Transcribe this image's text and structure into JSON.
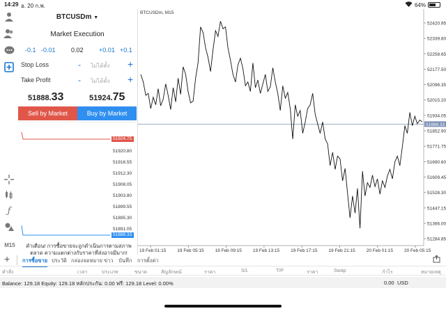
{
  "statusbar": {
    "time": "14:29",
    "date": "อ. 20 ก.พ.",
    "battery": "64%",
    "battery_level": 0.64
  },
  "toolbar_icons": [
    "user-icon",
    "users-icon",
    "chat-icon",
    "new-order-icon",
    "crosshair-icon",
    "chart-type-icon",
    "function-icon",
    "objects-icon"
  ],
  "timeframe": "M15",
  "order": {
    "symbol": "BTCUSDm",
    "execution": "Market Execution",
    "vol_minus_big": "-0.1",
    "vol_minus_small": "-0.01",
    "volume": "0.02",
    "vol_plus_small": "+0.01",
    "vol_plus_big": "+0.1",
    "stop_loss_label": "Stop Loss",
    "take_profit_label": "Take Profit",
    "not_set": "ไม่ได้ตั้ง",
    "bid_prefix": "51888.",
    "bid_big": "33",
    "ask_prefix": "51924.",
    "ask_big": "75",
    "sell_label": "Sell by Market",
    "buy_label": "Buy by Market",
    "warning": "คำเตือน! การซื้อขายจะถูกดำเนินการตามสภาพตลาด ความแตกต่างกับราคาที่ส่งอาจมีมาก!"
  },
  "tick_chart": {
    "ask_tag": "51924.75",
    "bid_tag": "51888.33",
    "levels": [
      "51920.80",
      "51916.55",
      "51912.30",
      "51908.05",
      "51903.80",
      "51899.55",
      "51895.30",
      "51891.05"
    ]
  },
  "chart_data": {
    "type": "line",
    "title": "BTCUSDm, M15",
    "x_labels": [
      "19 Feb 01:15",
      "19 Feb 05:15",
      "19 Feb 09:15",
      "19 Feb 13:15",
      "19 Feb 17:15",
      "19 Feb 21:15",
      "20 Feb 01:15",
      "20 Feb 05:15"
    ],
    "y_labels": [
      "52420.95",
      "52339.80",
      "52258.65",
      "52177.50",
      "52096.35",
      "52015.20",
      "51934.05",
      "51852.90",
      "51771.75",
      "51690.60",
      "51609.45",
      "51528.30",
      "51447.15",
      "51366.00",
      "51284.85"
    ],
    "ylim": [
      51249,
      52450
    ],
    "current_price_tag": "51888.33",
    "current_price": 51888.33,
    "values": [
      52150,
      52110,
      52040,
      52050,
      51970,
      52030,
      51990,
      52075,
      51985,
      52020,
      52100,
      52040,
      51965,
      52080,
      52005,
      52130,
      52045,
      52190,
      52150,
      52060,
      52000,
      52010,
      52130,
      52210,
      52400,
      52370,
      52290,
      52240,
      52165,
      52280,
      52380,
      52350,
      52430,
      52390,
      52400,
      52290,
      52225,
      52150,
      52110,
      52200,
      52235,
      52180,
      52090,
      52110,
      52060,
      52210,
      52080,
      52120,
      52050,
      52100,
      52150,
      52060,
      52085,
      52185,
      52110,
      52050,
      51960,
      52090,
      52025,
      52055,
      51970,
      51810,
      51990,
      51930,
      51960,
      51840,
      51900,
      51970,
      51990,
      52050,
      51940,
      51890,
      51840,
      51900,
      51810,
      51785,
      51670,
      51740,
      51650,
      51720,
      51705,
      51590,
      51655,
      51525,
      51395,
      51510,
      51420,
      51550,
      51340,
      51640,
      51510,
      51580,
      51555,
      51620,
      51560,
      51600,
      51520,
      51590,
      51555,
      51615,
      51650,
      51600,
      51690,
      51720,
      51670,
      51770,
      51880,
      51840,
      51950,
      51880,
      51930,
      51890,
      51910,
      51900
    ]
  },
  "bottom": {
    "tabs": [
      "การซื้อขาย",
      "ประวัติ",
      "กล่องจดหมาย",
      "ข่าว",
      "บันทึก",
      "การตั้งค่า"
    ],
    "columns": [
      "คำสั่ง",
      "เวลา",
      "ประเภท",
      "ขนาด",
      "สัญลักษณ์",
      "ราคา",
      "S/L",
      "T/P",
      "ราคา",
      "Swap",
      "กำไร",
      "หมายเหตุ"
    ],
    "balance_text": "Balance: 129.18 Equity: 129.18 หลักประกัน: 0.00 ฟรี: 129.18 Level: 0.00%",
    "total_profit": "0.00",
    "currency": "USD"
  }
}
